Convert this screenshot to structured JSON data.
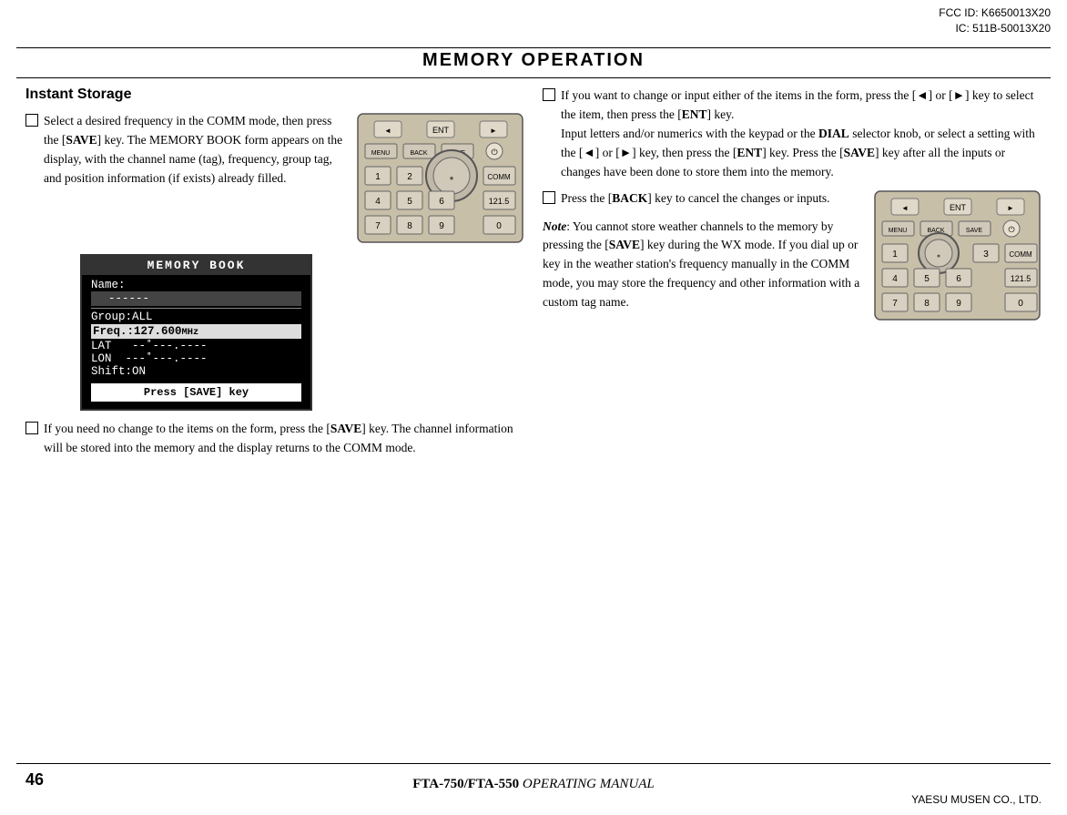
{
  "fcc": {
    "line1": "FCC ID: K6650013X20",
    "line2": "IC: 511B-50013X20"
  },
  "title": "Memory Operation",
  "left_col": {
    "heading": "Instant Storage",
    "para1": {
      "bullet": true,
      "text_parts": [
        "Select a desired fre-quency in the COMM mode, then press the [",
        "SAVE",
        "] key. The MEMORY BOOK form appears on the display, with the channel name (tag), frequency, group tag, and position in-formation (if exists) already filled."
      ]
    },
    "memory_book": {
      "title": "MEMORY BOOK",
      "name_label": "Name:",
      "name_value": "------",
      "group": "Group:ALL",
      "freq": "Freq.:127.600MHz",
      "lat": "LAT   --˚---.----",
      "lon": "LON  ---˚---.----",
      "shift": "Shift:ON",
      "press": "Press [SAVE] key"
    },
    "para2": {
      "bullet": true,
      "text": "If you need no change to the items on the form, press the [SAVE] key. The channel information will be stored into the memory and the display returns to the COMM mode."
    }
  },
  "right_col": {
    "para1": {
      "bullet": true,
      "text": "If you want to change or input either of the items in the form, press the [◄] or [►] key to select the item, then press the [ENT] key. Input letters and/or numerics with the keypad or the DIAL selector knob, or select a setting with the [◄] or [►] key, then press the [ENT] key. Press the [SAVE] key after all the inputs or changes have been done to store them into the memory."
    },
    "para2": {
      "bullet": true,
      "text_prefix": "Press the [BACK] key to cancel the changes or inputs."
    },
    "note": {
      "label": "Note",
      "text": ": You cannot store weather channels to the memory by pressing the [SAVE] key during the WX mode. If you dial up or key in the weather station's frequency manually in the COMM mode, you may store the fre-quency and other information with a custom tag name."
    }
  },
  "footer": {
    "page_num": "46",
    "title": "FTA-750/FTA-550 Operating Manual",
    "company": "YAESU MUSEN CO., LTD."
  }
}
